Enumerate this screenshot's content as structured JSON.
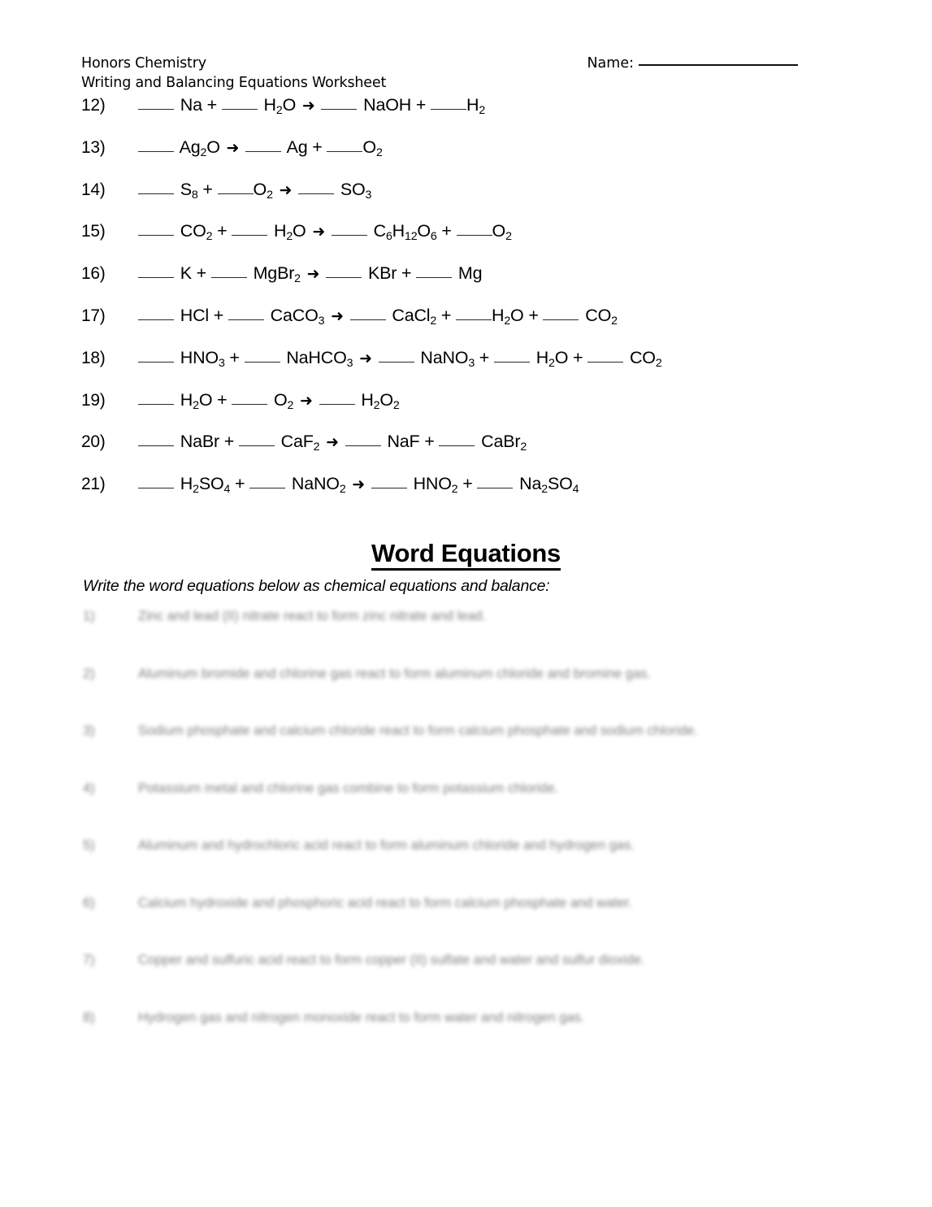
{
  "document": {
    "course": "Honors Chemistry",
    "worksheet_title": "Writing and Balancing Equations Worksheet",
    "name_label": "Name:",
    "background_color": "#ffffff",
    "text_color": "#000000"
  },
  "equations": [
    {
      "number": "12)",
      "html": "<span class='blank'></span> Na + <span class='blank'></span> H<sub>2</sub>O <span class='arw'>&#10140;</span> <span class='blank'></span> NaOH + <span class='blank tight'></span>H<sub>2</sub>",
      "plain": "____ Na + ____ H2O → ____ NaOH + ____H2"
    },
    {
      "number": "13)",
      "html": "<span class='blank'></span> Ag<sub>2</sub>O <span class='arw'>&#10140;</span> <span class='blank'></span> Ag + <span class='blank tight'></span>O<sub>2</sub>",
      "plain": "____ Ag2O → ____ Ag + ____O2"
    },
    {
      "number": "14)",
      "html": "<span class='blank'></span> S<sub>8</sub> + <span class='blank tight'></span>O<sub>2</sub> <span class='arw'>&#10140;</span> <span class='blank'></span> SO<sub>3</sub>",
      "plain": "____ S8 + ____O2 → ____ SO3"
    },
    {
      "number": "15)",
      "html": "<span class='blank'></span> CO<sub>2</sub> + <span class='blank'></span> H<sub>2</sub>O <span class='arw'>&#10140;</span> <span class='blank'></span> C<sub>6</sub>H<sub>12</sub>O<sub>6</sub> + <span class='blank tight'></span>O<sub>2</sub>",
      "plain": "____ CO2 + ____ H2O → ____ C6H12O6 + ____O2"
    },
    {
      "number": "16)",
      "html": "<span class='blank'></span> K + <span class='blank'></span> MgBr<sub>2</sub> <span class='arw'>&#10140;</span> <span class='blank'></span> KBr + <span class='blank'></span> Mg",
      "plain": "____ K + ____ MgBr2 → ____ KBr + ____ Mg"
    },
    {
      "number": "17)",
      "html": "<span class='blank'></span> HCl + <span class='blank'></span> CaCO<sub>3</sub> <span class='arw'>&#10140;</span> <span class='blank'></span> CaCl<sub>2</sub> + <span class='blank tight'></span>H<sub>2</sub>O + <span class='blank'></span> CO<sub>2</sub>",
      "plain": "____ HCl + ____ CaCO3 → ____ CaCl2 + ____H2O + ____ CO2"
    },
    {
      "number": "18)",
      "html": "<span class='blank'></span> HNO<sub>3</sub> + <span class='blank'></span> NaHCO<sub>3</sub> <span class='arw'>&#10140;</span> <span class='blank'></span> NaNO<sub>3</sub> + <span class='blank'></span> H<sub>2</sub>O + <span class='blank'></span> CO<sub>2</sub>",
      "plain": "____ HNO3 + ____ NaHCO3 → ____ NaNO3 + ____ H2O + ____ CO2"
    },
    {
      "number": "19)",
      "html": "<span class='blank'></span> H<sub>2</sub>O + <span class='blank'></span> O<sub>2</sub> <span class='arw'>&#10140;</span> <span class='blank'></span> H<sub>2</sub>O<sub>2</sub>",
      "plain": "____ H2O + ____ O2 → ____ H2O2"
    },
    {
      "number": "20)",
      "html": "<span class='blank'></span> NaBr + <span class='blank'></span> CaF<sub>2</sub> <span class='arw'>&#10140;</span> <span class='blank'></span> NaF + <span class='blank'></span> CaBr<sub>2</sub>",
      "plain": "____ NaBr + ____ CaF2 → ____ NaF + ____ CaBr2"
    },
    {
      "number": "21)",
      "html": "<span class='blank'></span> H<sub>2</sub>SO<sub>4</sub> + <span class='blank'></span> NaNO<sub>2</sub> <span class='arw'>&#10140;</span> <span class='blank'></span> HNO<sub>2</sub> + <span class='blank'></span> Na<sub>2</sub>SO<sub>4</sub>",
      "plain": "____ H2SO4 + ____ NaNO2 → ____ HNO2 + ____ Na2SO4"
    }
  ],
  "word_equations": {
    "heading": "Word Equations",
    "instruction": "Write the word equations below as chemical equations and balance:",
    "items": [
      {
        "number": "1)",
        "text": "Zinc and lead (II) nitrate react to form zinc nitrate and lead."
      },
      {
        "number": "2)",
        "text": "Aluminum bromide and chlorine gas react to form aluminum chloride and bromine gas."
      },
      {
        "number": "3)",
        "text": "Sodium phosphate and calcium chloride react to form calcium phosphate and sodium chloride."
      },
      {
        "number": "4)",
        "text": "Potassium metal and chlorine gas combine to form potassium chloride."
      },
      {
        "number": "5)",
        "text": "Aluminum and hydrochloric acid react to form aluminum chloride and hydrogen gas."
      },
      {
        "number": "6)",
        "text": "Calcium hydroxide and phosphoric acid react to form calcium phosphate and water."
      },
      {
        "number": "7)",
        "text": "Copper and sulfuric acid react to form copper (II) sulfate and water and sulfur dioxide."
      },
      {
        "number": "8)",
        "text": "Hydrogen gas and nitrogen monoxide react to form water and nitrogen gas."
      }
    ]
  }
}
